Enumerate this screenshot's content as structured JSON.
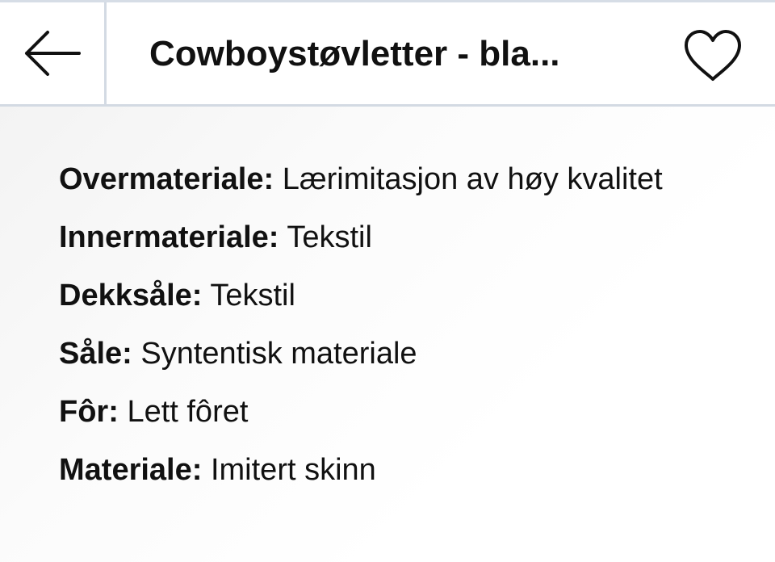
{
  "header": {
    "title": "Cowboystøvletter - bla...",
    "back_icon": "arrow-left-icon",
    "favorite_icon": "heart-outline-icon"
  },
  "details": [
    {
      "label": "Overmateriale:",
      "value": "Lærimitasjon av høy kvalitet"
    },
    {
      "label": "Innermateriale:",
      "value": "Tekstil"
    },
    {
      "label": "Dekksåle:",
      "value": "Tekstil"
    },
    {
      "label": "Såle:",
      "value": "Syntentisk materiale"
    },
    {
      "label": "Fôr:",
      "value": "Lett fôret"
    },
    {
      "label": "Materiale:",
      "value": "Imitert skinn"
    }
  ]
}
